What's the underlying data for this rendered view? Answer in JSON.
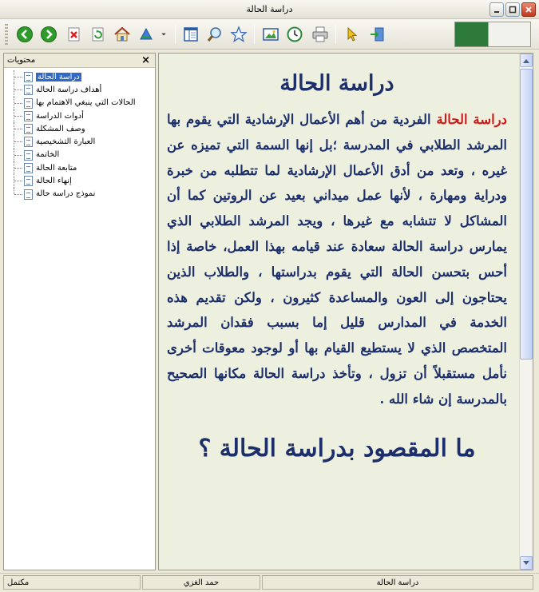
{
  "window": {
    "title": "دراسة الحالة"
  },
  "toolbar": {
    "buttons": [
      {
        "name": "back",
        "icon": "back-arrow-icon"
      },
      {
        "name": "forward",
        "icon": "forward-arrow-icon"
      },
      {
        "name": "stop",
        "icon": "stop-icon"
      },
      {
        "name": "refresh",
        "icon": "refresh-icon"
      },
      {
        "name": "home",
        "icon": "home-icon"
      },
      {
        "name": "sync",
        "icon": "sync-icon"
      },
      {
        "name": "contents",
        "icon": "contents-pane-icon"
      },
      {
        "name": "search",
        "icon": "search-icon"
      },
      {
        "name": "favorites",
        "icon": "star-icon"
      },
      {
        "name": "options",
        "icon": "picture-icon"
      },
      {
        "name": "history",
        "icon": "clock-icon"
      },
      {
        "name": "print",
        "icon": "printer-icon"
      },
      {
        "name": "select",
        "icon": "pointer-icon"
      },
      {
        "name": "exit",
        "icon": "exit-icon"
      }
    ]
  },
  "sidebar": {
    "title": "محتويات",
    "close": "×",
    "items": [
      {
        "label": "دراسة الحالة",
        "selected": true
      },
      {
        "label": "أهداف دراسة الحالة"
      },
      {
        "label": "الحالات التي ينبغي الاهتمام بها"
      },
      {
        "label": "أدوات الدراسة"
      },
      {
        "label": "وصف المشكلة"
      },
      {
        "label": "العبارة التشخيصية"
      },
      {
        "label": "الخاتمة"
      },
      {
        "label": "متابعة الحالة"
      },
      {
        "label": "إنهاء الحالة"
      },
      {
        "label": "نموذج دراسة حالة"
      }
    ]
  },
  "content": {
    "heading": "دراسة الحالة",
    "highlight": "دراسة الحالة",
    "body": " الفردية من أهم الأعمال الإرشادية التي يقوم بها المرشد الطلابي في المدرسة ؛بل إنها السمة التي تميزه عن غيره ، وتعد من أدق الأعمال الإرشادية لما تتطلبه من خبرة ودراية ومهارة ، لأنها عمل ميداني بعيد عن الروتين كما أن المشاكل لا تتشابه مع غيرها ، ويجد المرشد الطلابي الذي يمارس دراسة الحالة سعادة عند قيامه بهذا العمل، خاصة إذا أحس بتحسن الحالة التي يقوم بدراستها ، والطلاب الذين يحتاجون إلى العون والمساعدة كثيرون ، ولكن تقديم هذه الخدمة في المدارس قليل إما بسبب فقدان المرشد المتخصص الذي لا يستطيع القيام بها أو لوجود معوقات أخرى نأمل مستقبلاً أن تزول ، وتأخذ دراسة الحالة مكانها الصحيح بالمدرسة إن شاء الله .",
    "subheading": "ما المقصود بدراسة الحالة ؟"
  },
  "status": {
    "left": "مكتمل",
    "center": "حمد الغزي",
    "right": "دراسة الحالة"
  },
  "colors": {
    "text": "#1c2f6b",
    "highlight": "#d01818",
    "content_bg": "#eef0df",
    "selection": "#316ac5"
  }
}
